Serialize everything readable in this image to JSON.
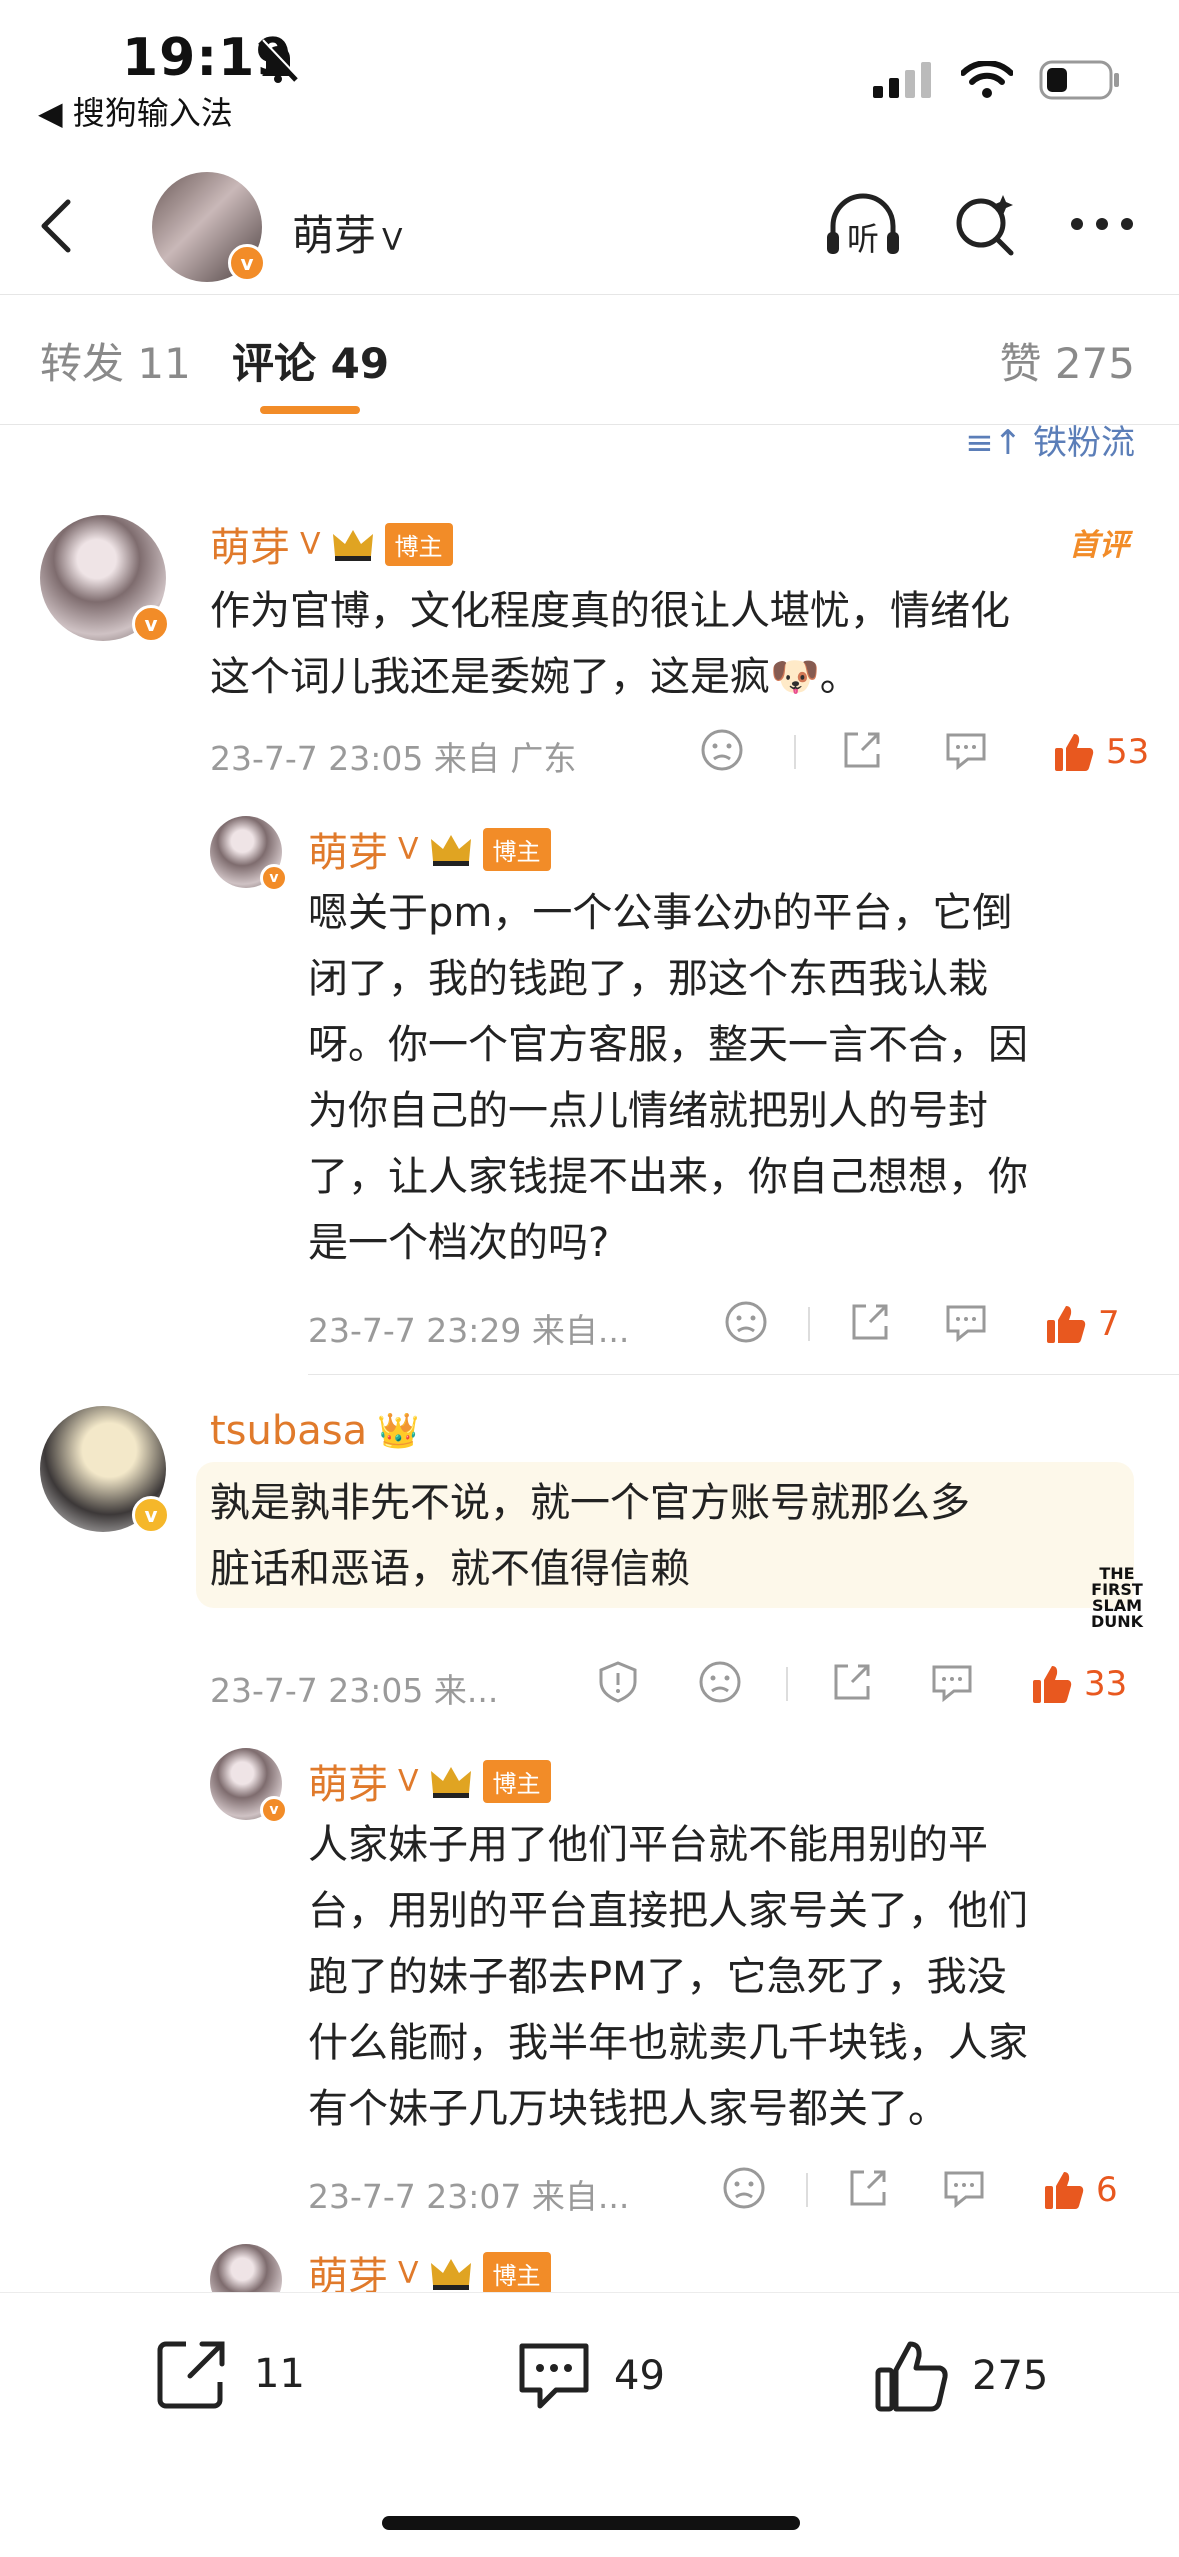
{
  "status_bar": {
    "time": "19:19",
    "back_app": "◀ 搜狗输入法"
  },
  "nav": {
    "username": "萌芽",
    "v_suffix": "ᐯ",
    "listen_label": "听"
  },
  "tabs": [
    {
      "label": "转发 11",
      "active": false
    },
    {
      "label": "评论 49",
      "active": true
    }
  ],
  "likes_tab": "赞 275",
  "sort_label": "≡↑ 铁粉流",
  "comments": [
    {
      "user": "萌芽",
      "v": "ᐯ",
      "tag": "博主",
      "first_label": "首评",
      "text_lines": [
        "作为官博，文化程度真的很让人堪忧，情绪化",
        "这个词儿我还是委婉了，这是疯🐶。"
      ],
      "meta": "23-7-7 23:05  来自 广东",
      "likes": "53"
    },
    {
      "user": "萌芽",
      "v": "ᐯ",
      "tag": "博主",
      "text_lines": [
        "嗯关于pm，一个公事公办的平台，它倒",
        "闭了，我的钱跑了，那这个东西我认栽",
        "呀。你一个官方客服，整天一言不合，因",
        "为你自己的一点儿情绪就把别人的号封",
        "了，让人家钱提不出来，你自己想想，你",
        "是一个档次的吗?"
      ],
      "meta": "23-7-7 23:29  来自...",
      "likes": "7"
    },
    {
      "user": "tsubasa",
      "crown": "👑",
      "text_lines": [
        "孰是孰非先不说，就一个官方账号就那么多",
        "脏话和恶语，就不值得信赖"
      ],
      "meta": "23-7-7 23:05  来...",
      "likes": "33",
      "watermark": "THE FIRST SLAM DUNK"
    },
    {
      "user": "萌芽",
      "v": "ᐯ",
      "tag": "博主",
      "text_lines": [
        "人家妹子用了他们平台就不能用别的平",
        "台，用别的平台直接把人家号关了，他们",
        "跑了的妹子都去PM了，它急死了，我没",
        "什么能耐，我半年也就卖几千块钱，人家",
        "有个妹子几万块钱把人家号都关了。"
      ],
      "meta": "23-7-7 23:07  来自...",
      "likes": "6"
    },
    {
      "user": "萌芽",
      "v": "ᐯ",
      "tag": "博主"
    }
  ],
  "bottom_bar": {
    "repost": "11",
    "comment": "49",
    "like": "275"
  },
  "colors": {
    "accent": "#f28c28",
    "username": "#e07a2b",
    "like": "#e8581f",
    "link": "#5b7eb8"
  }
}
